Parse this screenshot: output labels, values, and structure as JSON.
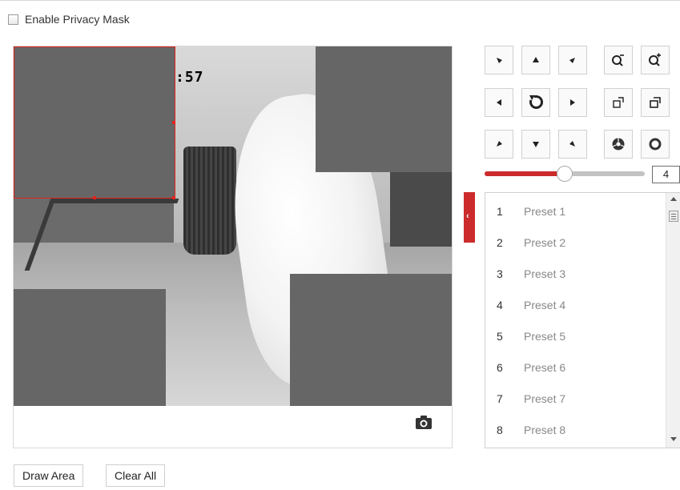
{
  "enable_privacy_mask": {
    "label": "Enable Privacy Mask",
    "checked": false
  },
  "video": {
    "osd_time_fragment": ":57",
    "snapshot_icon": "camera-icon"
  },
  "ptz": {
    "buttons": [
      {
        "name": "ptz-up-left-button",
        "icon": "arrow-up-left"
      },
      {
        "name": "ptz-up-button",
        "icon": "arrow-up"
      },
      {
        "name": "ptz-up-right-button",
        "icon": "arrow-up-right"
      },
      {
        "name": "zoom-out-button",
        "icon": "zoom-out-icon"
      },
      {
        "name": "zoom-in-button",
        "icon": "zoom-in-icon"
      },
      {
        "name": "ptz-left-button",
        "icon": "arrow-left"
      },
      {
        "name": "auto-pan-button",
        "icon": "refresh-icon"
      },
      {
        "name": "ptz-right-button",
        "icon": "arrow-right"
      },
      {
        "name": "focus-near-button",
        "icon": "focus-near-icon"
      },
      {
        "name": "focus-far-button",
        "icon": "focus-far-icon"
      },
      {
        "name": "ptz-down-left-button",
        "icon": "arrow-down-left"
      },
      {
        "name": "ptz-down-button",
        "icon": "arrow-down"
      },
      {
        "name": "ptz-down-right-button",
        "icon": "arrow-down-right"
      },
      {
        "name": "iris-open-button",
        "icon": "iris-open-icon"
      },
      {
        "name": "iris-close-button",
        "icon": "iris-close-icon"
      }
    ],
    "speed": {
      "value": "4",
      "fraction": 0.5
    }
  },
  "presets": [
    {
      "num": "1",
      "name": "Preset 1"
    },
    {
      "num": "2",
      "name": "Preset 2"
    },
    {
      "num": "3",
      "name": "Preset 3"
    },
    {
      "num": "4",
      "name": "Preset 4"
    },
    {
      "num": "5",
      "name": "Preset 5"
    },
    {
      "num": "6",
      "name": "Preset 6"
    },
    {
      "num": "7",
      "name": "Preset 7"
    },
    {
      "num": "8",
      "name": "Preset 8"
    }
  ],
  "buttons": {
    "draw_area": "Draw Area",
    "clear_all": "Clear All"
  },
  "colors": {
    "accent": "#cc2b2b",
    "mask": "#666666",
    "selection": "#e2231a"
  }
}
